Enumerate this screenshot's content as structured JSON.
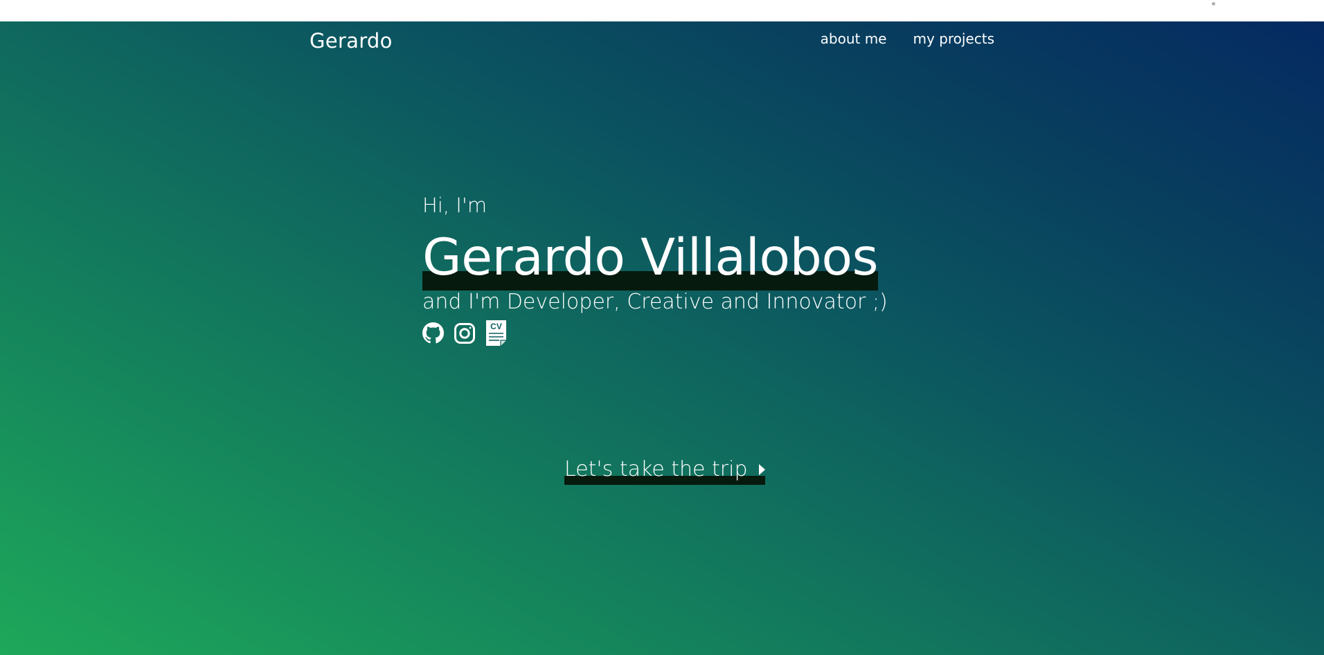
{
  "brand": {
    "name": "Gerardo"
  },
  "nav": {
    "items": [
      {
        "label": "about me"
      },
      {
        "label": "my projects"
      }
    ]
  },
  "hero": {
    "greeting": "Hi, I'm",
    "name": "Gerardo Villalobos",
    "tagline": "and I'm Developer, Creative and Innovator ;)",
    "socials": [
      {
        "icon": "github-icon"
      },
      {
        "icon": "instagram-icon"
      },
      {
        "icon": "cv-document-icon",
        "text": "CV"
      }
    ],
    "cta": {
      "label": "Let's take the trip",
      "icon": "caret-right-icon"
    }
  },
  "colors": {
    "gradient_start": "#1ea85a",
    "gradient_end": "#052a62",
    "highlight": "#061a0d",
    "text": "#ffffff"
  }
}
